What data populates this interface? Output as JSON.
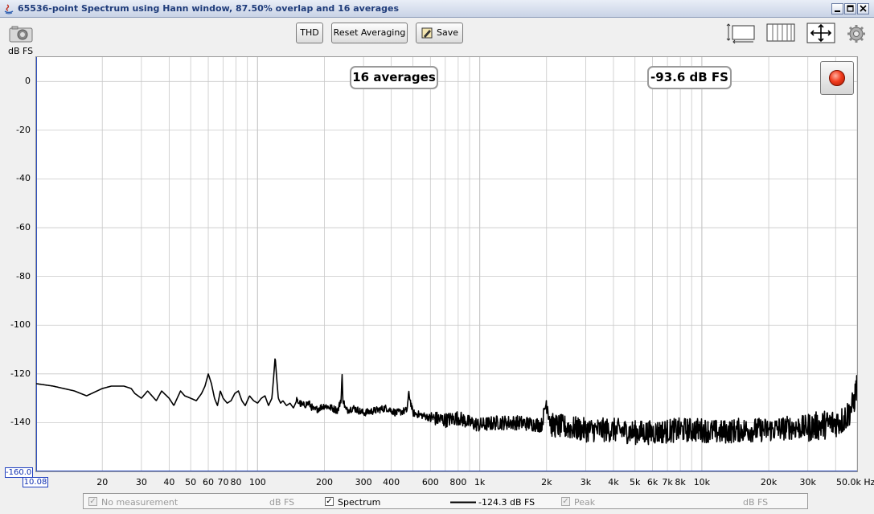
{
  "window": {
    "title": "65536-point Spectrum using Hann window, 87.50% overlap and 16 averages"
  },
  "toolbar": {
    "thd_label": "THD",
    "reset_label": "Reset Averaging",
    "save_label": "Save",
    "unit_label": "dB FS"
  },
  "overlays": {
    "averages": "16 averages",
    "level": "-93.6 dB FS"
  },
  "axes": {
    "y_ticks": [
      "0",
      "-20",
      "-40",
      "-60",
      "-80",
      "-100",
      "-120",
      "-140"
    ],
    "y_min_value": "-160.0",
    "x_min_value": "10.08",
    "x_ticks": [
      "20",
      "30",
      "40",
      "50",
      "60",
      "70",
      "80",
      "100",
      "200",
      "300",
      "400",
      "600",
      "800",
      "1k",
      "2k",
      "3k",
      "4k",
      "5k",
      "6k",
      "7k",
      "8k",
      "10k",
      "20k",
      "30k",
      "50.0k Hz"
    ]
  },
  "legend": {
    "items": [
      {
        "label": "No measurement",
        "value": "dB FS",
        "checked": true,
        "enabled": false
      },
      {
        "label": "Spectrum",
        "value": "-124.3 dB FS",
        "checked": true,
        "enabled": true
      },
      {
        "label": "Peak",
        "value": "dB FS",
        "checked": true,
        "enabled": false
      }
    ]
  },
  "colors": {
    "trace": "#000000",
    "grid": "#c8c8c8",
    "record": "#e8321a",
    "title": "#1f3c7a"
  },
  "chart_data": {
    "type": "line",
    "x_scale": "log",
    "xlim": [
      10.08,
      50000
    ],
    "ylim": [
      -160,
      10
    ],
    "xlabel": "Hz",
    "ylabel": "dB FS",
    "grid": true,
    "series": [
      {
        "name": "Spectrum",
        "x": [
          10.08,
          12,
          15,
          17,
          20,
          22,
          25,
          27,
          28,
          30,
          32,
          35,
          37,
          40,
          42,
          45,
          47,
          50,
          53,
          56,
          58,
          60,
          62,
          64,
          66,
          68,
          70,
          73,
          76,
          79,
          82,
          85,
          88,
          92,
          96,
          100,
          104,
          108,
          112,
          116,
          118,
          120,
          122,
          124,
          127,
          130,
          135,
          140,
          145,
          150,
          160,
          170,
          180,
          190,
          200,
          215,
          230,
          238,
          240,
          242,
          250,
          270,
          300,
          340,
          380,
          420,
          470,
          480,
          500,
          550,
          600,
          700,
          800,
          900,
          1000,
          1200,
          1500,
          1900,
          2000,
          2100,
          2500,
          3000,
          4000,
          5000,
          6000,
          8000,
          10000,
          12000,
          15000,
          20000,
          25000,
          30000,
          35000,
          40000,
          43000,
          45000,
          48000,
          50000
        ],
        "y": [
          -124,
          -125,
          -127,
          -129,
          -126,
          -125,
          -125,
          -126,
          -128,
          -130,
          -127,
          -131,
          -127,
          -130,
          -133,
          -127,
          -129,
          -130,
          -131,
          -128,
          -125,
          -120,
          -124,
          -130,
          -133,
          -127,
          -130,
          -132,
          -131,
          -128,
          -127,
          -131,
          -133,
          -129,
          -131,
          -132,
          -130,
          -129,
          -133,
          -130,
          -122,
          -113,
          -122,
          -130,
          -132,
          -131,
          -133,
          -132,
          -134,
          -131,
          -133,
          -132,
          -135,
          -134,
          -133,
          -134,
          -135,
          -130,
          -120,
          -130,
          -135,
          -134,
          -136,
          -135,
          -134,
          -136,
          -135,
          -128,
          -136,
          -137,
          -138,
          -139,
          -138,
          -140,
          -141,
          -140,
          -140,
          -141,
          -131,
          -141,
          -142,
          -143,
          -143,
          -144,
          -144,
          -143,
          -143,
          -144,
          -143,
          -143,
          -142,
          -142,
          -141,
          -140,
          -139,
          -137,
          -133,
          -124
        ]
      }
    ]
  }
}
